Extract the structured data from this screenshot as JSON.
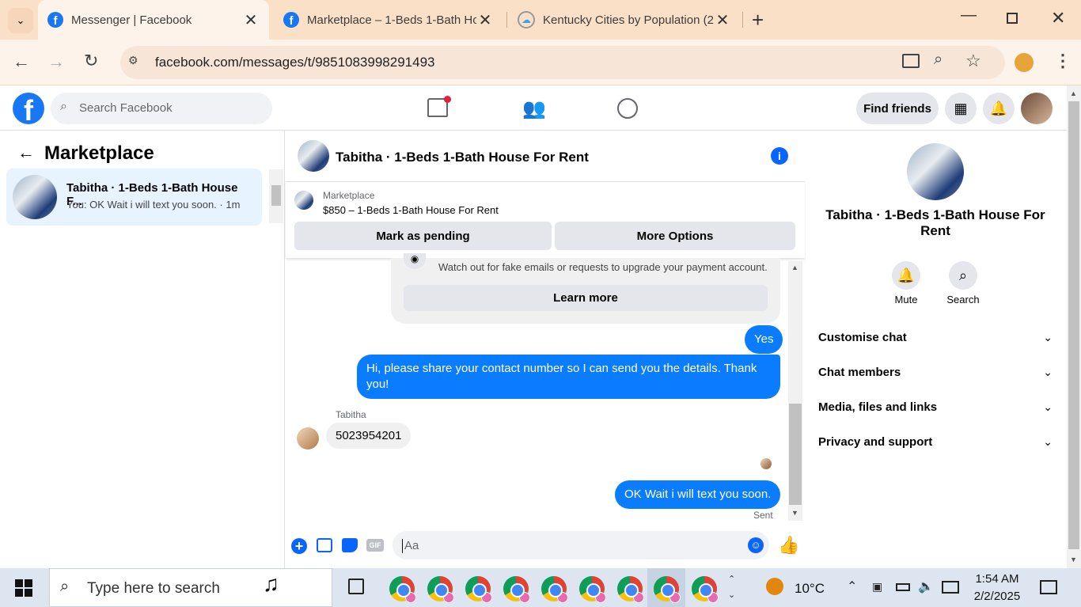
{
  "browser": {
    "tabs": [
      {
        "title": "Messenger | Facebook",
        "favicon": "facebook-icon"
      },
      {
        "title": "Marketplace – 1-Beds 1-Bath Ho",
        "favicon": "facebook-icon"
      },
      {
        "title": "Kentucky Cities by Population (2",
        "favicon": "cloud-icon"
      }
    ],
    "url": "facebook.com/messages/t/9851083998291493"
  },
  "header": {
    "search_placeholder": "Search Facebook",
    "find_friends": "Find friends"
  },
  "left_panel": {
    "title": "Marketplace",
    "conversation": {
      "name": "Tabitha · 1-Beds 1-Bath House F...",
      "preview": "You: OK Wait i will text you soon. · 1m"
    }
  },
  "chat": {
    "title": "Tabitha · 1-Beds 1-Bath House For Rent",
    "marketplace_label": "Marketplace",
    "listing": "$850 – 1-Beds 1-Bath House For Rent",
    "mark_pending": "Mark as pending",
    "more_options": "More Options",
    "warning_text": "Watch out for fake emails or requests to upgrade your payment account.",
    "learn_more": "Learn more",
    "messages": [
      {
        "from": "me",
        "text": "Yes"
      },
      {
        "from": "me",
        "text": "Hi, please share your contact number so I can send you the details. Thank you!"
      },
      {
        "from": "Tabitha",
        "sender_label": "Tabitha",
        "text": "5023954201"
      },
      {
        "from": "me",
        "text": "OK Wait i will text you soon."
      }
    ],
    "status": "Sent",
    "composer_placeholder": "Aa"
  },
  "right_panel": {
    "name": "Tabitha · 1-Beds 1-Bath House For Rent",
    "mute": "Mute",
    "search": "Search",
    "sections": [
      "Customise chat",
      "Chat members",
      "Media, files and links",
      "Privacy and support"
    ]
  },
  "taskbar": {
    "search_placeholder": "Type here to search",
    "weather": "10°C",
    "time": "1:54 AM",
    "date": "2/2/2025"
  },
  "colors": {
    "accent": "#1877f2",
    "bubble": "#0a7cff"
  }
}
